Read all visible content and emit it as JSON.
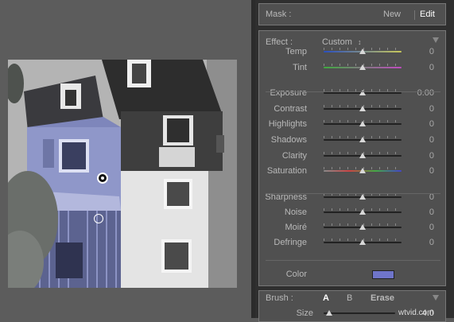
{
  "mask": {
    "label": "Mask :",
    "new_label": "New",
    "edit_label": "Edit"
  },
  "effect": {
    "label": "Effect :",
    "preset": "Custom",
    "preset_arrow": "↕"
  },
  "sliders": [
    {
      "id": "temp",
      "label": "Temp",
      "value": "0",
      "level": 0.5,
      "track": "temp"
    },
    {
      "id": "tint",
      "label": "Tint",
      "value": "0",
      "level": 0.5,
      "track": "tint"
    },
    {
      "id": "exposure",
      "label": "Exposure",
      "value": "0.00",
      "level": 0.5,
      "track": "plain"
    },
    {
      "id": "contrast",
      "label": "Contrast",
      "value": "0",
      "level": 0.5,
      "track": "plain"
    },
    {
      "id": "highlights",
      "label": "Highlights",
      "value": "0",
      "level": 0.5,
      "track": "plain"
    },
    {
      "id": "shadows",
      "label": "Shadows",
      "value": "0",
      "level": 0.5,
      "track": "plain"
    },
    {
      "id": "clarity",
      "label": "Clarity",
      "value": "0",
      "level": 0.5,
      "track": "plain"
    },
    {
      "id": "saturation",
      "label": "Saturation",
      "value": "0",
      "level": 0.5,
      "track": "saturation"
    },
    {
      "id": "sharpness",
      "label": "Sharpness",
      "value": "0",
      "level": 0.5,
      "track": "plain"
    },
    {
      "id": "noise",
      "label": "Noise",
      "value": "0",
      "level": 0.5,
      "track": "plain"
    },
    {
      "id": "moire",
      "label": "Moiré",
      "value": "0",
      "level": 0.5,
      "track": "plain"
    },
    {
      "id": "defringe",
      "label": "Defringe",
      "value": "0",
      "level": 0.5,
      "track": "plain"
    }
  ],
  "color": {
    "label": "Color",
    "swatch": "#6f75c9"
  },
  "brush": {
    "label": "Brush :",
    "a": "A",
    "b": "B",
    "erase": "Erase",
    "size_label": "Size",
    "size_value": "4.0"
  },
  "watermark": "wtvid.com",
  "colors": {
    "mask_overlay": "#7c86c8",
    "panel_bg": "#505050",
    "accent": "#ffffff"
  }
}
